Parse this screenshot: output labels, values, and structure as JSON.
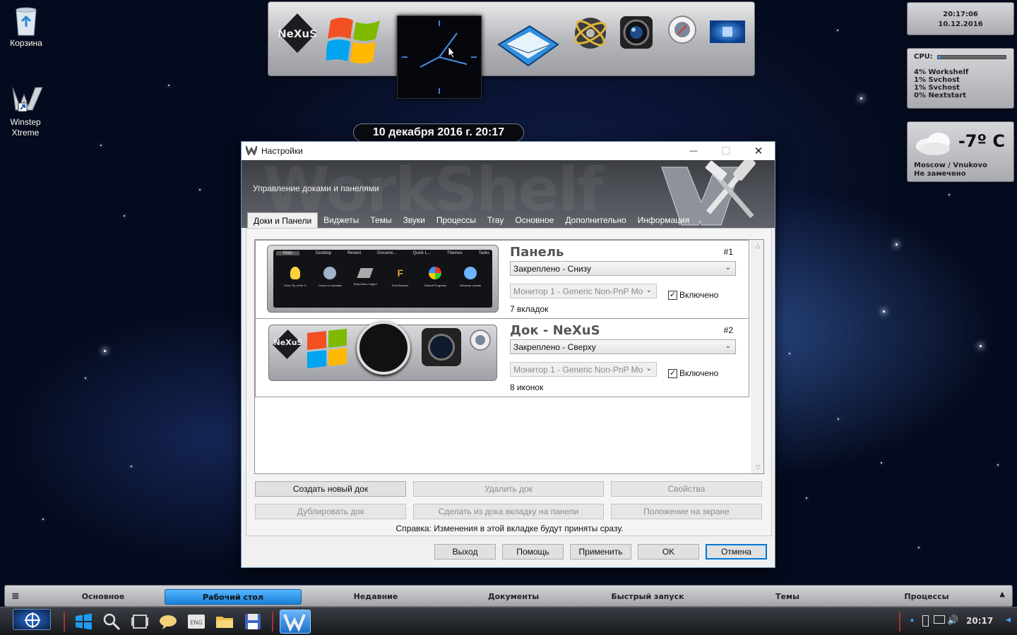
{
  "desktop": {
    "icons": [
      {
        "label": "Корзина"
      },
      {
        "label": "Winstep Xtreme"
      }
    ],
    "date_bubble": "10 декабря 2016 г. 20:17"
  },
  "widgets": {
    "clock": {
      "time": "20:17:06",
      "date": "10.12.2016"
    },
    "cpu": {
      "label": "CPU:",
      "usage_fraction": 0.04,
      "processes": [
        "4% Workshelf",
        "1% Svchost",
        "1% Svchost",
        "0% Nextstart"
      ]
    },
    "weather": {
      "temp": "-7º C",
      "location": "Moscow / Vnukovo",
      "condition": "Не замечено"
    }
  },
  "window": {
    "title": "Настройки",
    "controls": {
      "minimize": "—",
      "maximize": "☐",
      "close": "✕"
    },
    "banner_watermark": "WorkShelf",
    "subtitle": "Управление доками и панелями",
    "tabs": [
      "Доки и Панели",
      "Виджеты",
      "Темы",
      "Звуки",
      "Процессы",
      "Tray",
      "Основное",
      "Дополнительно",
      "Информация"
    ],
    "entries": [
      {
        "name": "Панель",
        "number": "#1",
        "position": "Закреплено - Снизу",
        "monitor": "Монитор 1 - Generic Non-PnP Mo",
        "enabled_label": "Включено",
        "enabled": true,
        "count": "7 вкладок",
        "thumb_tabs": [
          "Main",
          "Desktop",
          "Recent",
          "Docume...",
          "Quick L...",
          "Themes",
          "Tasks"
        ],
        "thumb_items": [
          "Show Tip of the D",
          "Check for Updates",
          "Start Menu Organi",
          "Font Browser",
          "Default Programs",
          "Windows Update"
        ]
      },
      {
        "name": "Док - NeXuS",
        "number": "#2",
        "position": "Закреплено - Сверху",
        "monitor": "Монитор 1 - Generic Non-PnP Mo",
        "enabled_label": "Включено",
        "enabled": true,
        "count": "8 иконок",
        "thumb_logo": "NeXuS"
      }
    ],
    "buttons_row1": [
      "Создать новый док",
      "Удалить док",
      "Свойства"
    ],
    "buttons_row2": [
      "Дублировать док",
      "Сделать из дока вкладку на панели",
      "Положение на экране"
    ],
    "help": "Справка: Изменения в этой вкладке будут приняты сразу.",
    "footer": [
      "Выход",
      "Помощь",
      "Применить",
      "OK",
      "Отмена"
    ]
  },
  "dock_top": {
    "logo": "NeXuS"
  },
  "panel_tabs": {
    "menu_icon": "≡",
    "items": [
      "Основное",
      "Рабочий стол",
      "Недавние",
      "Документы",
      "Быстрый запуск",
      "Темы",
      "Процессы"
    ],
    "active": "Рабочий стол"
  },
  "taskbar": {
    "time": "20:17",
    "icons": [
      "start-orb-icon",
      "windows-icon",
      "search-icon",
      "task-view-icon",
      "chat-icon",
      "keyboard-eng-icon",
      "folder-icon",
      "floppy-icon",
      "winstep-icon"
    ]
  }
}
